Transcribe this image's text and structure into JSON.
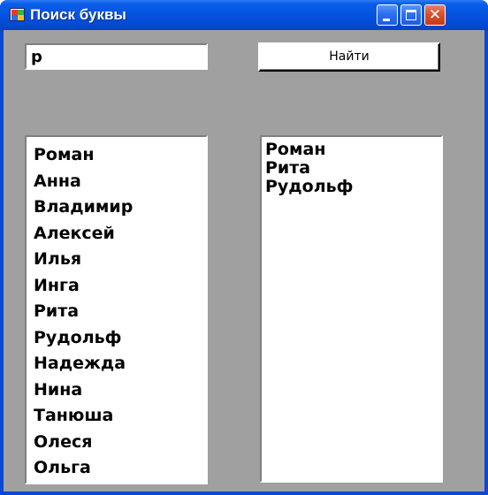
{
  "window": {
    "title": "Поиск буквы",
    "colors": {
      "titlebar": "#0553de",
      "client": "#a0a0a0",
      "close": "#d9502e"
    }
  },
  "title_buttons": {
    "minimize_icon": "minimize-icon",
    "maximize_icon": "maximize-icon",
    "close_icon": "close-icon",
    "close_glyph": "✕"
  },
  "search": {
    "value": "р"
  },
  "find_button": {
    "label": "Найти"
  },
  "source_list": {
    "items": [
      "Роман",
      "Анна",
      "Владимир",
      "Алексей",
      "Илья",
      "Инга",
      "Рита",
      "Рудольф",
      "Надежда",
      "Нина",
      "Танюша",
      "Олеся",
      "Ольга"
    ]
  },
  "result_list": {
    "items": [
      "Роман",
      "Рита",
      "Рудольф"
    ]
  }
}
